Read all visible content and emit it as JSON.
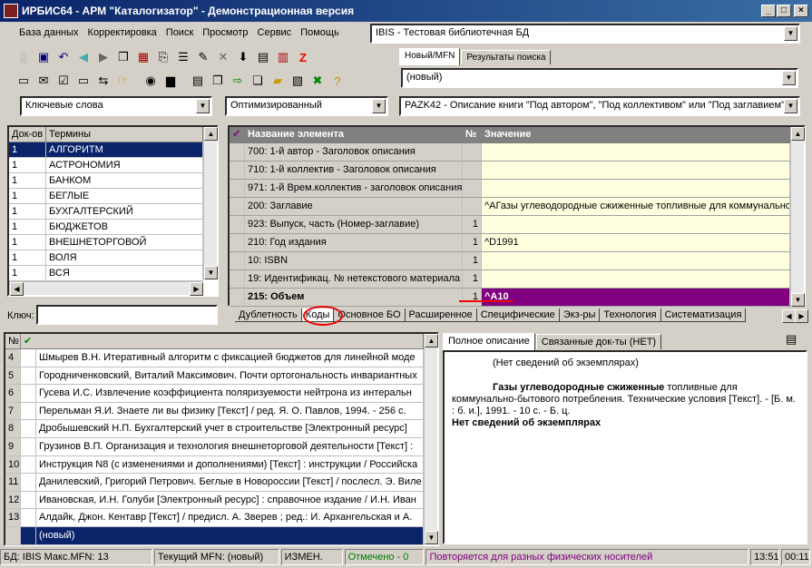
{
  "window": {
    "title": "ИРБИС64 - АРМ \"Каталогизатор\" - Демонстрационная версия"
  },
  "menu": [
    "База данных",
    "Корректировка",
    "Поиск",
    "Просмотр",
    "Сервис",
    "Помощь"
  ],
  "db_combo": "IBIS - Тестовая библиотечная БД",
  "right_tabs": {
    "new_mfn": "Новый/MFN",
    "results": "Результаты поиска"
  },
  "new_combo": "(новый)",
  "search_mode": "Ключевые слова",
  "optim": "Оптимизированный",
  "worksheet": "PAZK42 - Описание книги \"Под автором\", \"Под коллективом\" или \"Под заглавием\"",
  "dict": {
    "headers": [
      "Док-ов",
      "Термины"
    ],
    "rows": [
      [
        "1",
        "АЛГОРИТМ"
      ],
      [
        "1",
        "АСТРОНОМИЯ"
      ],
      [
        "1",
        "БАНКОМ"
      ],
      [
        "1",
        "БЕГЛЫЕ"
      ],
      [
        "1",
        "БУХГАЛТЕРСКИЙ"
      ],
      [
        "1",
        "БЮДЖЕТОВ"
      ],
      [
        "1",
        "ВНЕШНЕТОРГОВОЙ"
      ],
      [
        "1",
        "ВОЛЯ"
      ],
      [
        "1",
        "ВСЯ"
      ]
    ],
    "key_label": "Ключ:"
  },
  "editor": {
    "headers": [
      "Название элемента",
      "№",
      "Значение"
    ],
    "rows": [
      [
        "700: 1-й  автор - Заголовок описания",
        "",
        ""
      ],
      [
        "710: 1-й коллектив - Заголовок описания",
        "",
        ""
      ],
      [
        "971: 1-й Врем.коллектив - заголовок описания",
        "",
        ""
      ],
      [
        "200: Заглавие",
        "",
        "^AГазы углеводородные сжиженные топливные для коммунально"
      ],
      [
        "923: Выпуск, часть (Номер-заглавие)",
        "1",
        ""
      ],
      [
        "210: Год издания",
        "1",
        "^D1991"
      ],
      [
        "10: ISBN",
        "1",
        ""
      ],
      [
        "19: Идентификац. № нетекстового материала",
        "1",
        ""
      ],
      [
        "215: Объем",
        "1",
        "^A10"
      ]
    ],
    "tabs": [
      "Дублетность",
      "Коды",
      "Основное БО",
      "Расширенное",
      "Специфические",
      "Экз-ры",
      "Технология",
      "Систематизация"
    ]
  },
  "list": {
    "headers": [
      "№",
      "✔"
    ],
    "rows": [
      [
        "4",
        "Шмырев В.Н. Итеративный алгоритм с фиксацией бюджетов для линейной моде"
      ],
      [
        "5",
        "Городниченковский, Виталий Максимович. Почти ортогональность инвариантных"
      ],
      [
        "6",
        "Гусева И.С. Извлечение коэффициента поляризуемости нейтрона из интеральн"
      ],
      [
        "7",
        "Перельман Я.И. Знаете ли вы физику [Текст] / ред. Я. О. Павлов, 1994. - 256 с."
      ],
      [
        "8",
        "Дробышевский Н.П. Бухгалтерский учет в строительстве [Электронный ресурс]"
      ],
      [
        "9",
        "Грузинов В.П. Организация и технология внешнеторговой деятельности [Текст] :"
      ],
      [
        "10",
        "Инструкция N8    (с изменениями и дополнениями) [Текст] : инструкции / Российска"
      ],
      [
        "11",
        "Данилевский, Григорий Петрович. Беглые в Новороссии [Текст] / послесл. Э. Виле"
      ],
      [
        "12",
        "Ивановская, И.Н. Голуби [Электронный ресурс] : справочное издание / И.Н. Иван"
      ],
      [
        "13",
        "Алдайк, Джон. Кентавр [Текст] / предисл. А. Зверев ; ред.: И. Архангельская и А."
      ],
      [
        "",
        "(новый)"
      ]
    ]
  },
  "desc": {
    "tab_full": "Полное описание",
    "tab_linked": "Связанные док-ты (НЕТ)",
    "line1": "(Нет сведений об экземплярах)",
    "bold1": "Газы углеводородные сжиженные",
    "rest1": " топливные для",
    "line2": "коммунально-бытового потребления. Технические условия [Текст]. - [Б. м.",
    "line3": ": б. и.], 1991. - 10 с. - Б. ц.",
    "line4": "Нет сведений об экземплярах"
  },
  "status": {
    "db": "БД: IBIS Макс.MFN: 13",
    "cur": "Текущий MFN: (новый)",
    "changed": "ИЗМЕН.",
    "marked": "Отмечено - 0",
    "hint": "Повторяется для разных физических носителей",
    "time": "13:51",
    "timer": "00:11"
  },
  "colors": {
    "marked": "#008000",
    "hint": "#800080",
    "highlight": "#800080"
  }
}
